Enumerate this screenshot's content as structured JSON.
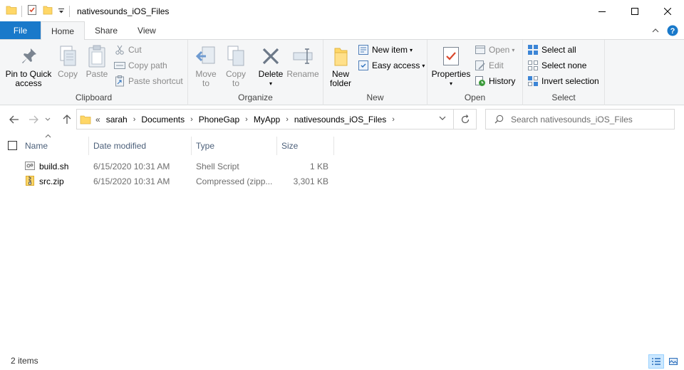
{
  "window": {
    "title": "nativesounds_iOS_Files"
  },
  "tabs": {
    "file": "File",
    "home": "Home",
    "share": "Share",
    "view": "View"
  },
  "ribbon": {
    "clipboard": {
      "label": "Clipboard",
      "pin_line1": "Pin to Quick",
      "pin_line2": "access",
      "copy": "Copy",
      "paste": "Paste",
      "cut": "Cut",
      "copy_path": "Copy path",
      "paste_shortcut": "Paste shortcut"
    },
    "organize": {
      "label": "Organize",
      "move_line1": "Move",
      "move_line2": "to",
      "copy_line1": "Copy",
      "copy_line2": "to",
      "delete": "Delete",
      "rename": "Rename"
    },
    "new": {
      "label": "New",
      "folder_line1": "New",
      "folder_line2": "folder",
      "new_item": "New item",
      "easy_access": "Easy access"
    },
    "open": {
      "label": "Open",
      "properties": "Properties",
      "open": "Open",
      "edit": "Edit",
      "history": "History"
    },
    "select": {
      "label": "Select",
      "select_all": "Select all",
      "select_none": "Select none",
      "invert_selection": "Invert selection"
    }
  },
  "address": {
    "overflow": "«",
    "breadcrumbs": [
      "sarah",
      "Documents",
      "PhoneGap",
      "MyApp",
      "nativesounds_iOS_Files"
    ]
  },
  "search": {
    "placeholder": "Search nativesounds_iOS_Files"
  },
  "columns": {
    "name": "Name",
    "date": "Date modified",
    "type": "Type",
    "size": "Size"
  },
  "files": [
    {
      "name": "build.sh",
      "date": "6/15/2020 10:31 AM",
      "type": "Shell Script",
      "size": "1 KB",
      "icon": "script-file-icon"
    },
    {
      "name": "src.zip",
      "date": "6/15/2020 10:31 AM",
      "type": "Compressed (zipp...",
      "size": "3,301 KB",
      "icon": "zip-folder-icon"
    }
  ],
  "status": {
    "count": "2 items"
  },
  "colors": {
    "file_tab": "#1979ca",
    "ribbon_bg": "#f5f6f7",
    "folder_yellow": "#ffd767",
    "column_header_text": "#4c607a"
  }
}
